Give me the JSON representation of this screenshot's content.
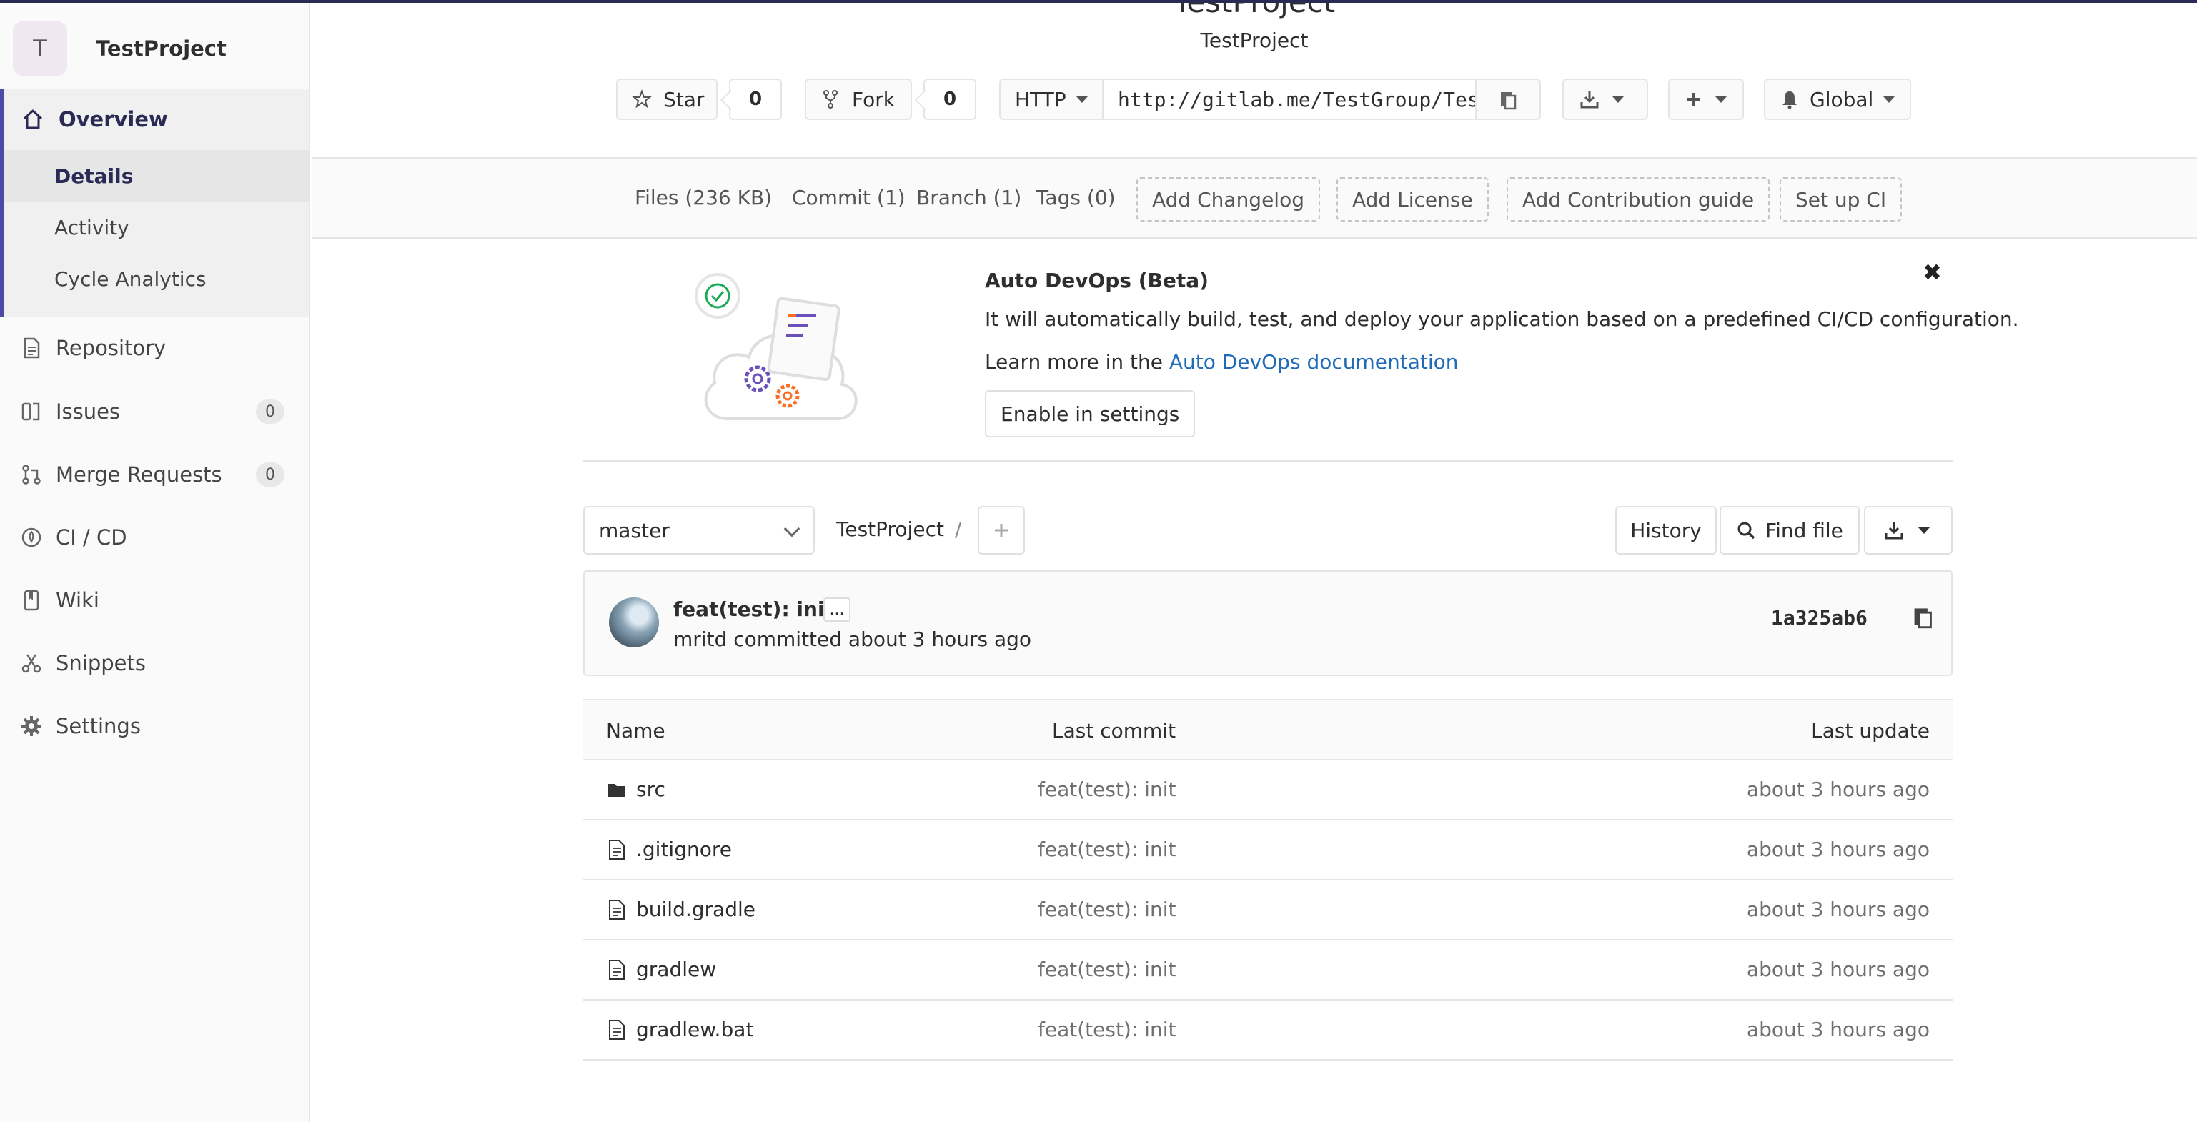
{
  "sidebar": {
    "avatar_letter": "T",
    "project_name": "TestProject",
    "overview": {
      "label": "Overview",
      "subitems": [
        "Details",
        "Activity",
        "Cycle Analytics"
      ]
    },
    "items": [
      {
        "label": "Repository",
        "icon": "doc-icon"
      },
      {
        "label": "Issues",
        "icon": "issues-icon",
        "badge": "0"
      },
      {
        "label": "Merge Requests",
        "icon": "merge-request-icon",
        "badge": "0"
      },
      {
        "label": "CI / CD",
        "icon": "rocket-icon"
      },
      {
        "label": "Wiki",
        "icon": "book-icon"
      },
      {
        "label": "Snippets",
        "icon": "scissors-icon"
      },
      {
        "label": "Settings",
        "icon": "gear-icon"
      }
    ]
  },
  "header": {
    "title": "TestProject",
    "subtitle": "TestProject",
    "star_label": "Star",
    "star_count": "0",
    "fork_label": "Fork",
    "fork_count": "0",
    "protocol": "HTTP",
    "clone_url": "http://gitlab.me/TestGroup/TestProject.git",
    "notification_label": "Global"
  },
  "stats": {
    "files": "Files (236 KB)",
    "commits": "Commit (1)",
    "branches": "Branch (1)",
    "tags": "Tags (0)",
    "add_changelog": "Add Changelog",
    "add_license": "Add License",
    "add_contribution": "Add Contribution guide",
    "setup_ci": "Set up CI"
  },
  "devops": {
    "title": "Auto DevOps (Beta)",
    "text": "It will automatically build, test, and deploy your application based on a predefined CI/CD configuration.",
    "learn_prefix": "Learn more in the ",
    "learn_link": "Auto DevOps documentation",
    "enable_button": "Enable in settings"
  },
  "tree": {
    "branch": "master",
    "breadcrumb": "TestProject",
    "separator": "/",
    "history_label": "History",
    "find_file_label": "Find file"
  },
  "commit": {
    "title": "feat(test): init",
    "ellipsis": "...",
    "meta": "mritd committed about 3 hours ago",
    "sha": "1a325ab6"
  },
  "files": {
    "headers": {
      "name": "Name",
      "last_commit": "Last commit",
      "last_update": "Last update"
    },
    "rows": [
      {
        "name": "src",
        "type": "folder",
        "commit": "feat(test): init",
        "updated": "about 3 hours ago"
      },
      {
        "name": ".gitignore",
        "type": "file",
        "commit": "feat(test): init",
        "updated": "about 3 hours ago"
      },
      {
        "name": "build.gradle",
        "type": "file",
        "commit": "feat(test): init",
        "updated": "about 3 hours ago"
      },
      {
        "name": "gradlew",
        "type": "file",
        "commit": "feat(test): init",
        "updated": "about 3 hours ago"
      },
      {
        "name": "gradlew.bat",
        "type": "file",
        "commit": "feat(test): init",
        "updated": "about 3 hours ago"
      }
    ]
  },
  "colors": {
    "accent": "#4b4ba3",
    "nav_text": "#2b2a55",
    "link": "#1f6bb8"
  }
}
